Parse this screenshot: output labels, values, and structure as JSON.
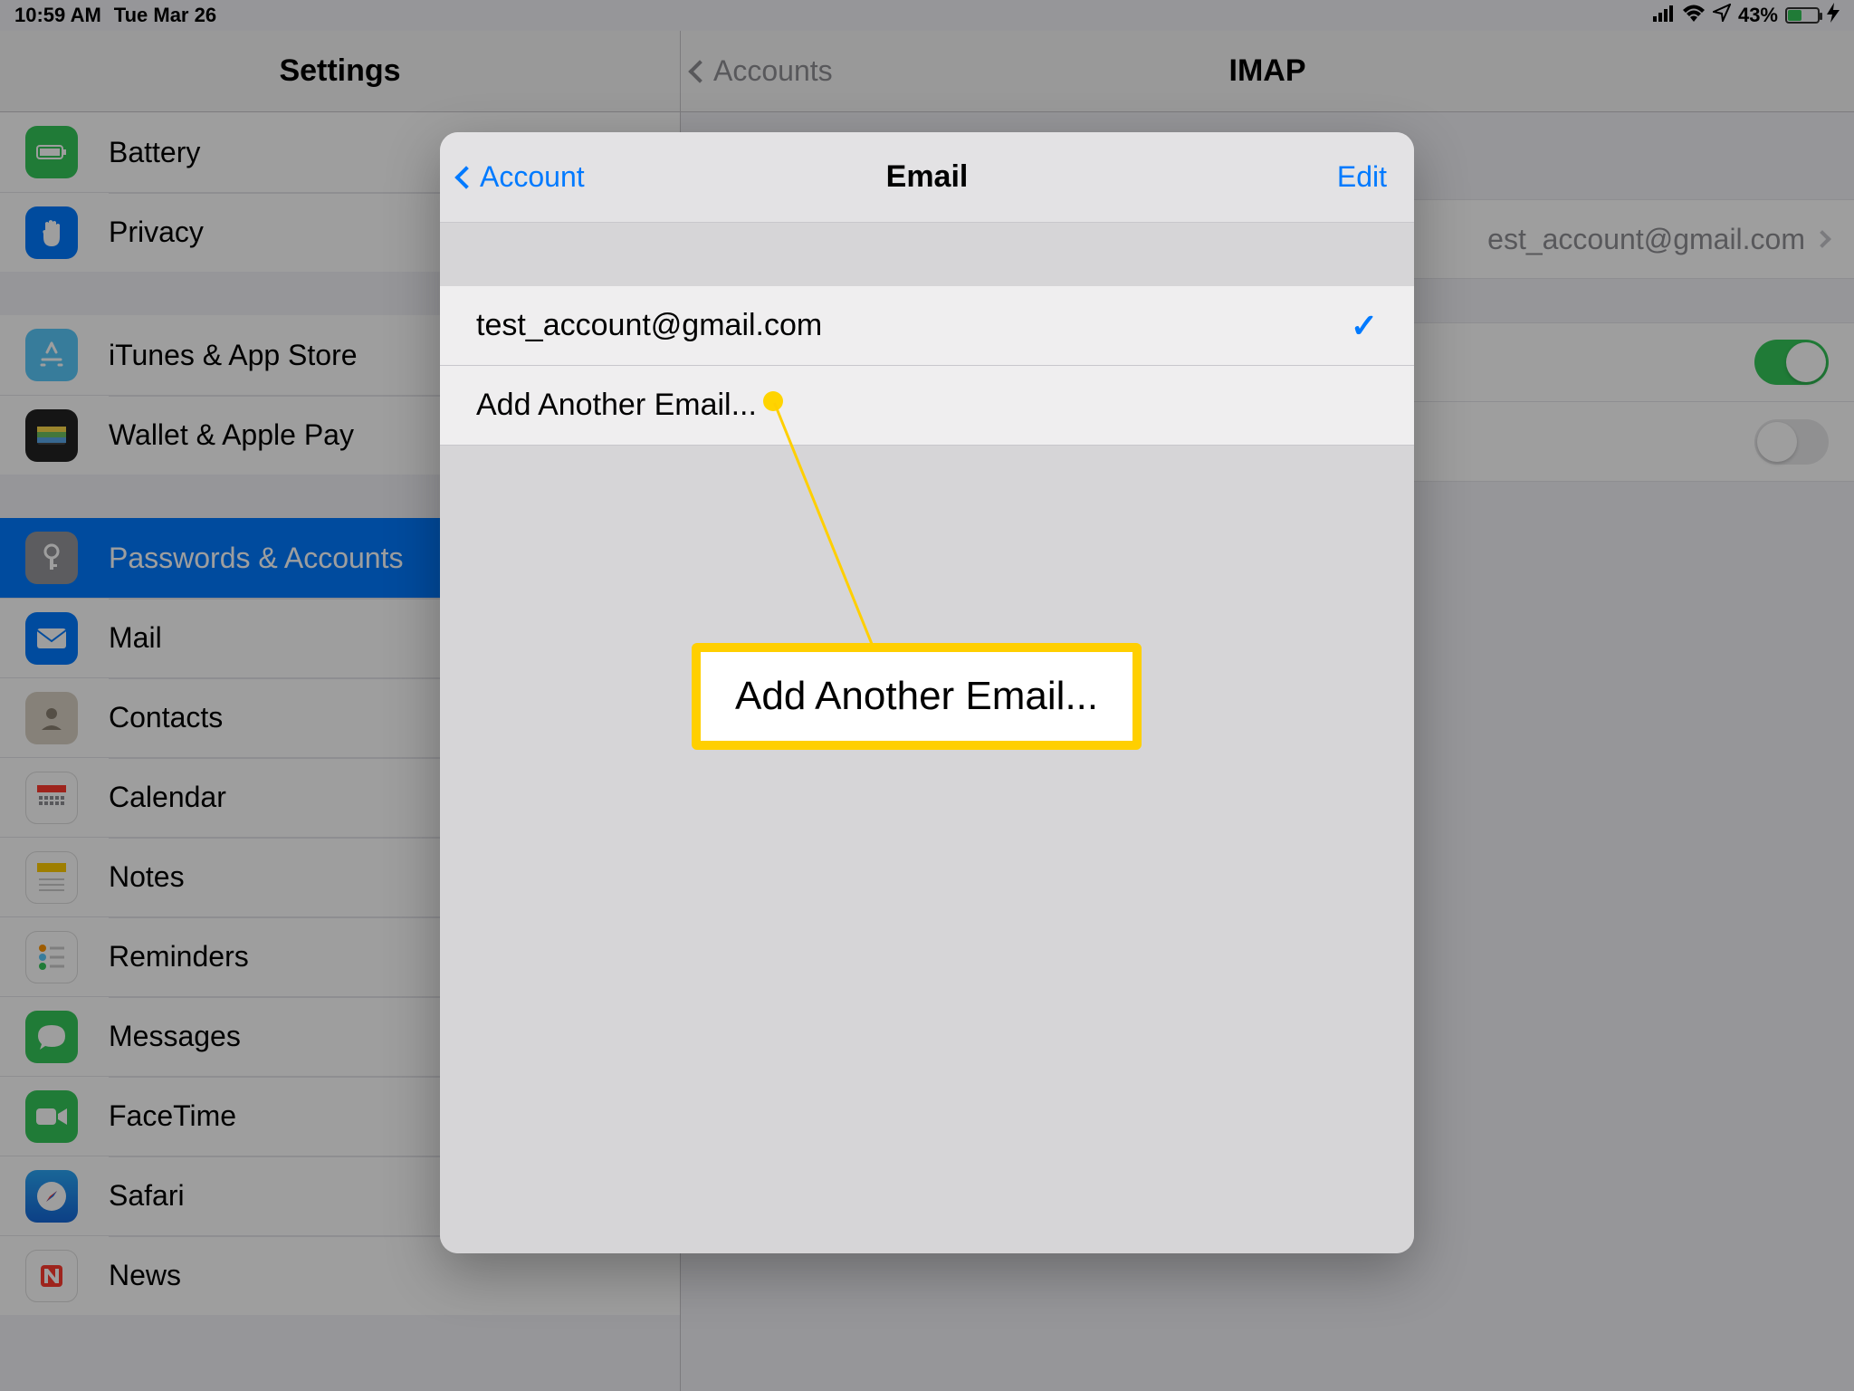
{
  "statusbar": {
    "time": "10:59 AM",
    "date": "Tue Mar 26",
    "battery_pct": "43%"
  },
  "sidebar": {
    "title": "Settings",
    "items": [
      {
        "label": "Battery",
        "icon": "battery-icon",
        "color": "ic-green"
      },
      {
        "label": "Privacy",
        "icon": "hand-icon",
        "color": "ic-blue"
      }
    ],
    "items2": [
      {
        "label": "iTunes & App Store",
        "icon": "appstore-icon",
        "color": "ic-lightblue"
      },
      {
        "label": "Wallet & Apple Pay",
        "icon": "wallet-icon",
        "color": "ic-white"
      }
    ],
    "items3": [
      {
        "label": "Passwords & Accounts",
        "icon": "key-icon",
        "color": "ic-gray",
        "selected": true
      },
      {
        "label": "Mail",
        "icon": "mail-icon",
        "color": "ic-blue"
      },
      {
        "label": "Contacts",
        "icon": "contacts-icon",
        "color": "ic-gray"
      },
      {
        "label": "Calendar",
        "icon": "calendar-icon",
        "color": "ic-white"
      },
      {
        "label": "Notes",
        "icon": "notes-icon",
        "color": "ic-yellow"
      },
      {
        "label": "Reminders",
        "icon": "reminders-icon",
        "color": "ic-white"
      },
      {
        "label": "Messages",
        "icon": "messages-icon",
        "color": "ic-green"
      },
      {
        "label": "FaceTime",
        "icon": "facetime-icon",
        "color": "ic-green"
      },
      {
        "label": "Safari",
        "icon": "safari-icon",
        "color": "ic-blue"
      },
      {
        "label": "News",
        "icon": "news-icon",
        "color": "ic-red"
      }
    ]
  },
  "detail": {
    "back": "Accounts",
    "title": "IMAP",
    "account_value": "est_account@gmail.com",
    "toggles": [
      {
        "on": true
      },
      {
        "on": false
      }
    ]
  },
  "modal": {
    "back": "Account",
    "title": "Email",
    "edit": "Edit",
    "rows": [
      {
        "label": "test_account@gmail.com",
        "checked": true
      },
      {
        "label": "Add Another Email...",
        "checked": false
      }
    ]
  },
  "callout": {
    "text": "Add Another Email..."
  }
}
